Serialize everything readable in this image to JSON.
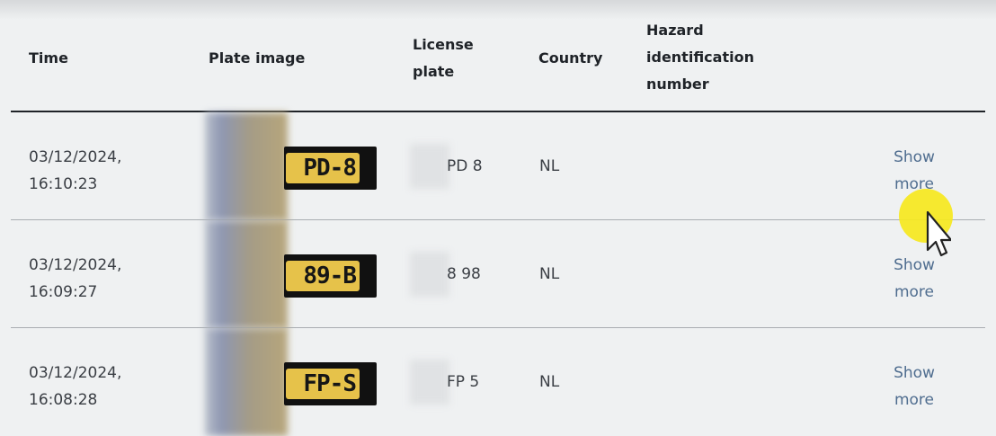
{
  "table": {
    "headers": {
      "time": "Time",
      "plate_image": "Plate image",
      "license_plate": [
        "License",
        "plate"
      ],
      "country": "Country",
      "hazard": [
        "Hazard",
        "identification",
        "number"
      ]
    },
    "rows": [
      {
        "date": "03/12/2024,",
        "time": "16:10:23",
        "plate_chars": "PD-8",
        "license_plate": "PD 8",
        "country": "NL",
        "more": [
          "Show",
          "more"
        ]
      },
      {
        "date": "03/12/2024,",
        "time": "16:09:27",
        "plate_chars": "89-B",
        "license_plate": "8 98",
        "country": "NL",
        "more": [
          "Show",
          "more"
        ]
      },
      {
        "date": "03/12/2024,",
        "time": "16:08:28",
        "plate_chars": "FP-S",
        "license_plate": "FP 5",
        "country": "NL",
        "more": [
          "Show",
          "more"
        ]
      }
    ]
  },
  "colors": {
    "background": "#eff1f2",
    "link": "#4f6d8f",
    "plate_yellow": "#e6c24a",
    "cursor_highlight": "#f6e81e"
  },
  "icons": {
    "cursor": "mouse-pointer-icon"
  }
}
